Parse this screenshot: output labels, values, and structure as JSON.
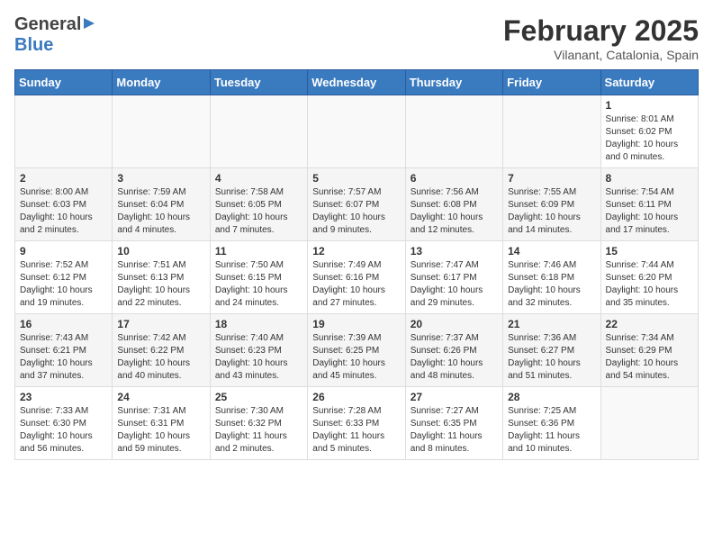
{
  "header": {
    "logo_general": "General",
    "logo_blue": "Blue",
    "month_title": "February 2025",
    "location": "Vilanant, Catalonia, Spain"
  },
  "calendar": {
    "days_of_week": [
      "Sunday",
      "Monday",
      "Tuesday",
      "Wednesday",
      "Thursday",
      "Friday",
      "Saturday"
    ],
    "weeks": [
      {
        "days": [
          {
            "num": "",
            "info": ""
          },
          {
            "num": "",
            "info": ""
          },
          {
            "num": "",
            "info": ""
          },
          {
            "num": "",
            "info": ""
          },
          {
            "num": "",
            "info": ""
          },
          {
            "num": "",
            "info": ""
          },
          {
            "num": "1",
            "info": "Sunrise: 8:01 AM\nSunset: 6:02 PM\nDaylight: 10 hours\nand 0 minutes."
          }
        ]
      },
      {
        "days": [
          {
            "num": "2",
            "info": "Sunrise: 8:00 AM\nSunset: 6:03 PM\nDaylight: 10 hours\nand 2 minutes."
          },
          {
            "num": "3",
            "info": "Sunrise: 7:59 AM\nSunset: 6:04 PM\nDaylight: 10 hours\nand 4 minutes."
          },
          {
            "num": "4",
            "info": "Sunrise: 7:58 AM\nSunset: 6:05 PM\nDaylight: 10 hours\nand 7 minutes."
          },
          {
            "num": "5",
            "info": "Sunrise: 7:57 AM\nSunset: 6:07 PM\nDaylight: 10 hours\nand 9 minutes."
          },
          {
            "num": "6",
            "info": "Sunrise: 7:56 AM\nSunset: 6:08 PM\nDaylight: 10 hours\nand 12 minutes."
          },
          {
            "num": "7",
            "info": "Sunrise: 7:55 AM\nSunset: 6:09 PM\nDaylight: 10 hours\nand 14 minutes."
          },
          {
            "num": "8",
            "info": "Sunrise: 7:54 AM\nSunset: 6:11 PM\nDaylight: 10 hours\nand 17 minutes."
          }
        ]
      },
      {
        "days": [
          {
            "num": "9",
            "info": "Sunrise: 7:52 AM\nSunset: 6:12 PM\nDaylight: 10 hours\nand 19 minutes."
          },
          {
            "num": "10",
            "info": "Sunrise: 7:51 AM\nSunset: 6:13 PM\nDaylight: 10 hours\nand 22 minutes."
          },
          {
            "num": "11",
            "info": "Sunrise: 7:50 AM\nSunset: 6:15 PM\nDaylight: 10 hours\nand 24 minutes."
          },
          {
            "num": "12",
            "info": "Sunrise: 7:49 AM\nSunset: 6:16 PM\nDaylight: 10 hours\nand 27 minutes."
          },
          {
            "num": "13",
            "info": "Sunrise: 7:47 AM\nSunset: 6:17 PM\nDaylight: 10 hours\nand 29 minutes."
          },
          {
            "num": "14",
            "info": "Sunrise: 7:46 AM\nSunset: 6:18 PM\nDaylight: 10 hours\nand 32 minutes."
          },
          {
            "num": "15",
            "info": "Sunrise: 7:44 AM\nSunset: 6:20 PM\nDaylight: 10 hours\nand 35 minutes."
          }
        ]
      },
      {
        "days": [
          {
            "num": "16",
            "info": "Sunrise: 7:43 AM\nSunset: 6:21 PM\nDaylight: 10 hours\nand 37 minutes."
          },
          {
            "num": "17",
            "info": "Sunrise: 7:42 AM\nSunset: 6:22 PM\nDaylight: 10 hours\nand 40 minutes."
          },
          {
            "num": "18",
            "info": "Sunrise: 7:40 AM\nSunset: 6:23 PM\nDaylight: 10 hours\nand 43 minutes."
          },
          {
            "num": "19",
            "info": "Sunrise: 7:39 AM\nSunset: 6:25 PM\nDaylight: 10 hours\nand 45 minutes."
          },
          {
            "num": "20",
            "info": "Sunrise: 7:37 AM\nSunset: 6:26 PM\nDaylight: 10 hours\nand 48 minutes."
          },
          {
            "num": "21",
            "info": "Sunrise: 7:36 AM\nSunset: 6:27 PM\nDaylight: 10 hours\nand 51 minutes."
          },
          {
            "num": "22",
            "info": "Sunrise: 7:34 AM\nSunset: 6:29 PM\nDaylight: 10 hours\nand 54 minutes."
          }
        ]
      },
      {
        "days": [
          {
            "num": "23",
            "info": "Sunrise: 7:33 AM\nSunset: 6:30 PM\nDaylight: 10 hours\nand 56 minutes."
          },
          {
            "num": "24",
            "info": "Sunrise: 7:31 AM\nSunset: 6:31 PM\nDaylight: 10 hours\nand 59 minutes."
          },
          {
            "num": "25",
            "info": "Sunrise: 7:30 AM\nSunset: 6:32 PM\nDaylight: 11 hours\nand 2 minutes."
          },
          {
            "num": "26",
            "info": "Sunrise: 7:28 AM\nSunset: 6:33 PM\nDaylight: 11 hours\nand 5 minutes."
          },
          {
            "num": "27",
            "info": "Sunrise: 7:27 AM\nSunset: 6:35 PM\nDaylight: 11 hours\nand 8 minutes."
          },
          {
            "num": "28",
            "info": "Sunrise: 7:25 AM\nSunset: 6:36 PM\nDaylight: 11 hours\nand 10 minutes."
          },
          {
            "num": "",
            "info": ""
          }
        ]
      }
    ]
  }
}
